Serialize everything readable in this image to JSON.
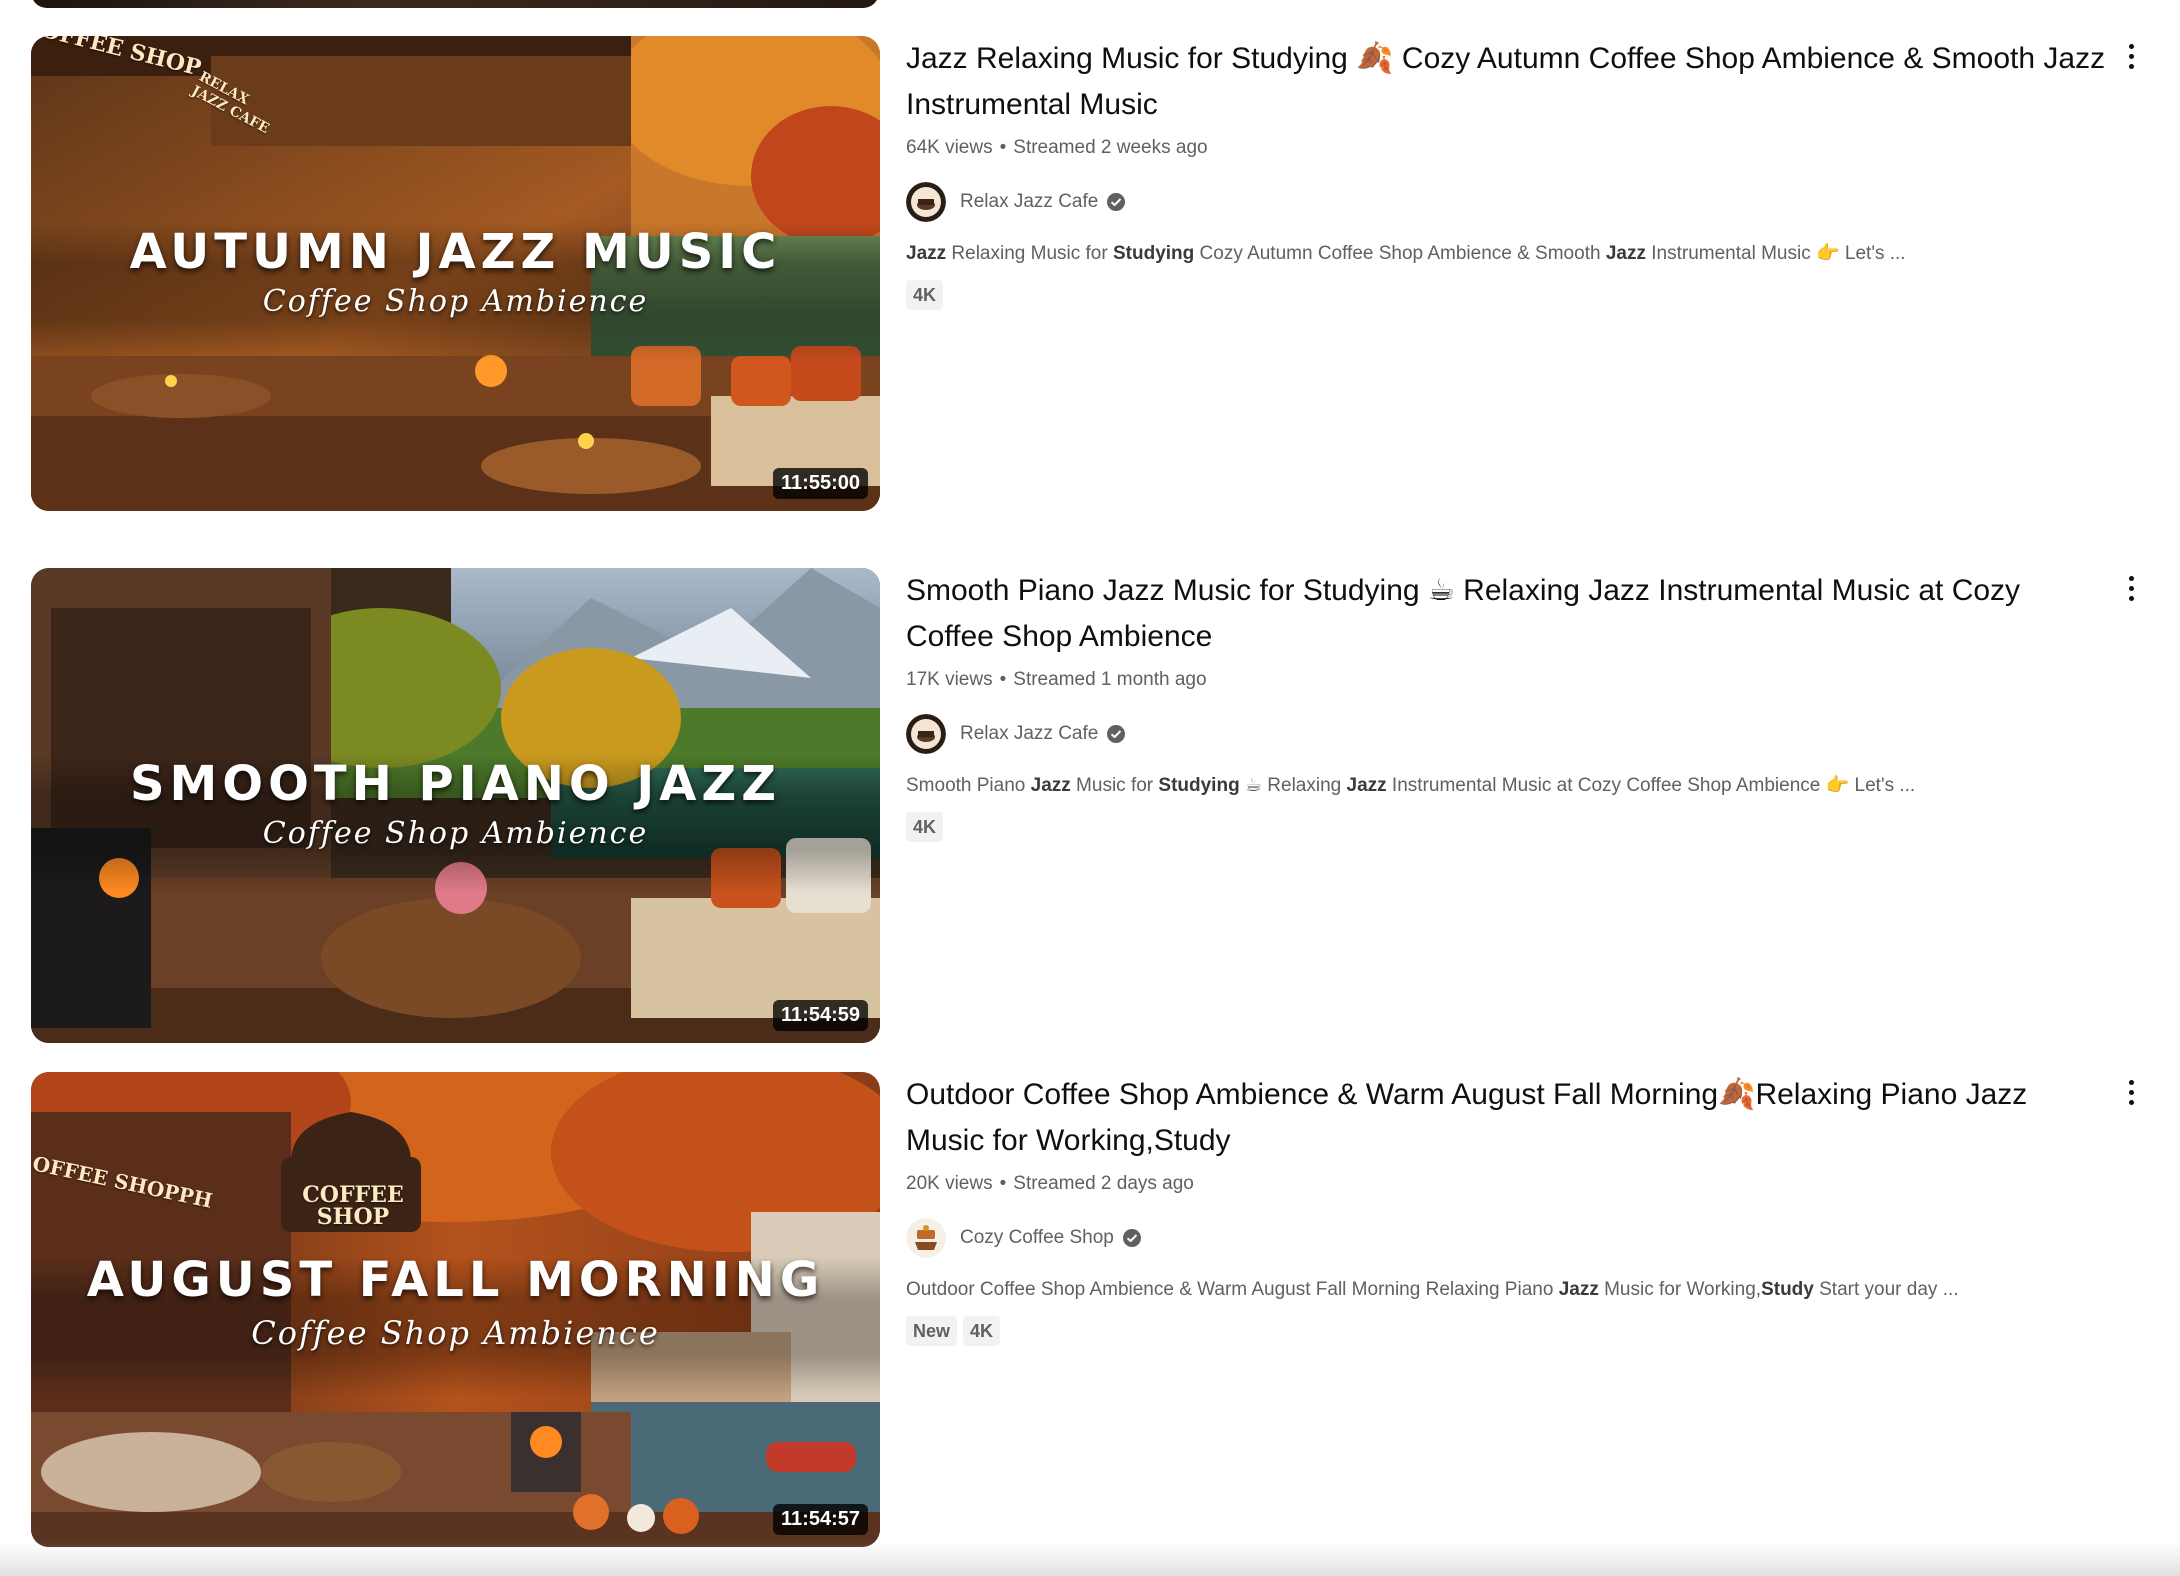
{
  "results": [
    {
      "thumbnail": {
        "title": "AUTUMN JAZZ MUSIC",
        "subtitle": "Coffee Shop Ambience",
        "signs": [
          "OFFEE SHOP",
          "RELAX JAZZ CAFE"
        ],
        "duration": "11:55:00"
      },
      "title_parts": [
        "Jazz Relaxing Music for Studying ",
        "🍂",
        " Cozy Autumn Coffee Shop Ambience & Smooth Jazz Instrumental Music"
      ],
      "views": "64K views",
      "age": "Streamed 2 weeks ago",
      "channel": "Relax Jazz Cafe",
      "description_parts": [
        {
          "text": "Jazz",
          "bold": true
        },
        {
          "text": " Relaxing Music for ",
          "bold": false
        },
        {
          "text": "Studying",
          "bold": true
        },
        {
          "text": " Cozy Autumn Coffee Shop Ambience & Smooth ",
          "bold": false
        },
        {
          "text": "Jazz",
          "bold": true
        },
        {
          "text": " Instrumental Music 👉 Let's ...",
          "bold": false
        }
      ],
      "badges": [
        "4K"
      ]
    },
    {
      "thumbnail": {
        "title": "SMOOTH PIANO JAZZ",
        "subtitle": "Coffee Shop Ambience",
        "signs": [],
        "duration": "11:54:59"
      },
      "title_parts": [
        "Smooth Piano Jazz Music for Studying ",
        "☕",
        " Relaxing Jazz Instrumental Music at Cozy Coffee Shop Ambience"
      ],
      "views": "17K views",
      "age": "Streamed 1 month ago",
      "channel": "Relax Jazz Cafe",
      "description_parts": [
        {
          "text": "Smooth Piano ",
          "bold": false
        },
        {
          "text": "Jazz",
          "bold": true
        },
        {
          "text": " Music for ",
          "bold": false
        },
        {
          "text": "Studying",
          "bold": true
        },
        {
          "text": " ☕ Relaxing ",
          "bold": false
        },
        {
          "text": "Jazz",
          "bold": true
        },
        {
          "text": " Instrumental Music at Cozy Coffee Shop Ambience 👉 Let's ...",
          "bold": false
        }
      ],
      "badges": [
        "4K"
      ]
    },
    {
      "thumbnail": {
        "title": "AUGUST FALL MORNING",
        "subtitle": "Coffee Shop Ambience",
        "signs": [
          "COFFEE SHOP",
          "OFFEE SHOPPH"
        ],
        "duration": "11:54:57"
      },
      "title_parts": [
        "Outdoor Coffee Shop Ambience & Warm August Fall Morning",
        "🍂",
        "Relaxing Piano Jazz Music for Working,Study"
      ],
      "views": "20K views",
      "age": "Streamed 2 days ago",
      "channel": "Cozy Coffee Shop",
      "description_parts": [
        {
          "text": "Outdoor Coffee Shop Ambience & Warm August Fall Morning Relaxing Piano ",
          "bold": false
        },
        {
          "text": "Jazz",
          "bold": true
        },
        {
          "text": " Music for Working,",
          "bold": false
        },
        {
          "text": "Study",
          "bold": true
        },
        {
          "text": " Start your day ...",
          "bold": false
        }
      ],
      "badges": [
        "New",
        "4K"
      ]
    }
  ],
  "icons": {
    "more": "more-vert-icon",
    "verified": "verified-check-icon"
  },
  "colors": {
    "title_text": "#0f0f0f",
    "meta_text": "#606060",
    "badge_bg": "#f2f2f2",
    "duration_bg": "#000000"
  }
}
